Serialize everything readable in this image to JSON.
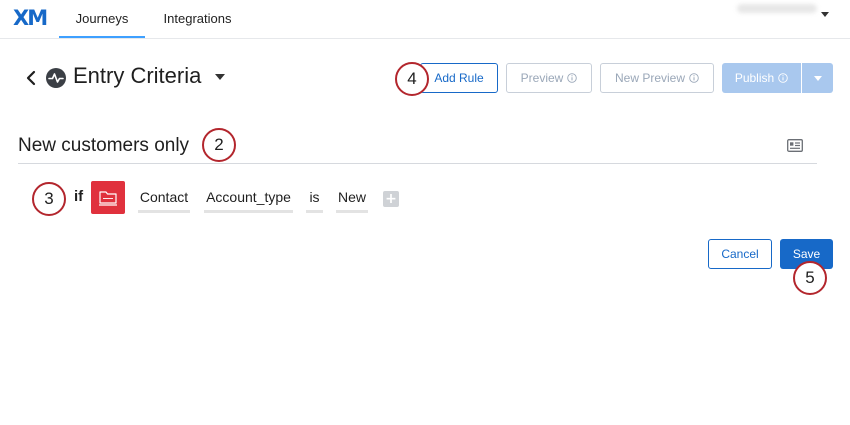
{
  "app": {
    "logo_text": "XM",
    "tabs": [
      {
        "label": "Journeys",
        "active": true
      },
      {
        "label": "Integrations",
        "active": false
      }
    ]
  },
  "header": {
    "title": "Entry Criteria",
    "buttons": {
      "add_rule": "Add Rule",
      "preview": "Preview",
      "new_preview": "New Preview",
      "publish": "Publish"
    }
  },
  "rule": {
    "name": "New customers only",
    "condition": {
      "keyword": "if",
      "tokens": [
        "Contact",
        "Account_type",
        "is",
        "New"
      ],
      "add_symbol": "+"
    }
  },
  "footer": {
    "cancel": "Cancel",
    "save": "Save"
  },
  "callouts": [
    "2",
    "3",
    "4",
    "5"
  ],
  "icons": {
    "back": "chevron-left-icon",
    "journey": "pulse-icon",
    "title_menu": "caret-down-icon",
    "info": "info-icon",
    "publish_menu": "caret-down-icon",
    "rule_card": "id-card-icon",
    "contact": "contact-folder-icon",
    "add_condition": "plus-icon"
  },
  "colors": {
    "brand_blue": "#1769c8",
    "tab_underline": "#3ea0ff",
    "disabled_publish": "#a9c8ee",
    "disabled_text": "#9aa7b8",
    "contact_red": "#e0313d",
    "callout_border": "#b3262d"
  }
}
